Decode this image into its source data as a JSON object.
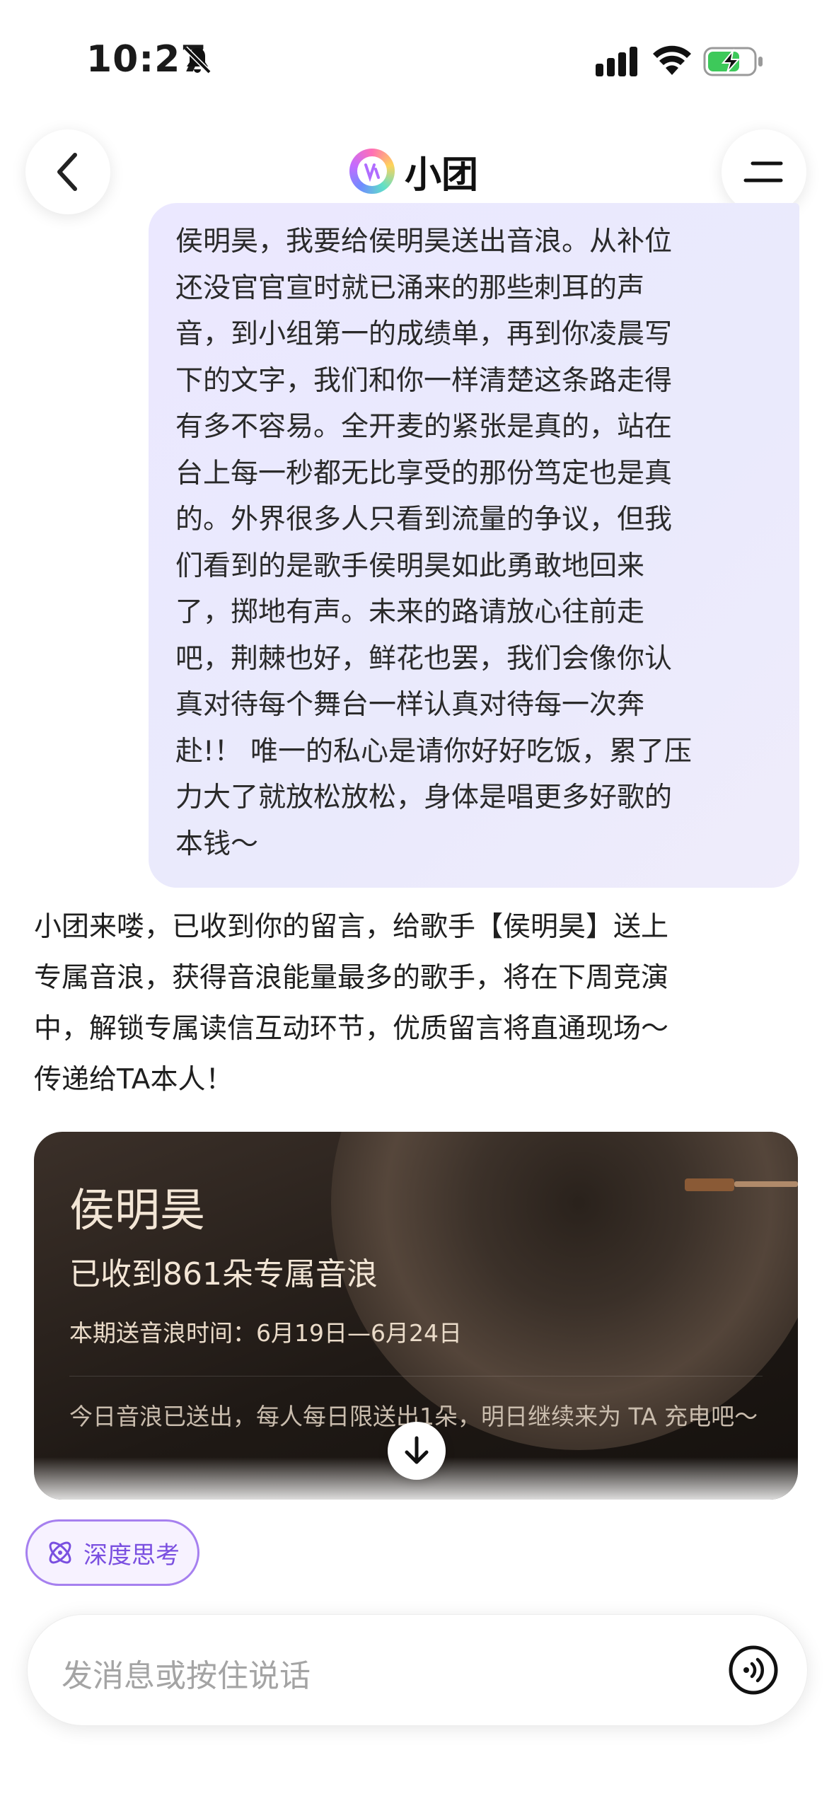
{
  "status_bar": {
    "time": "10:27"
  },
  "header": {
    "title": "小团"
  },
  "user_message": {
    "lines": [
      "侯明昊，我要给侯明昊送出音浪。从补位",
      "还没官官宣时就已涌来的那些刺耳的声",
      "音，到小组第一的成绩单，再到你凌晨写",
      "下的文字，我们和你一样清楚这条路走得",
      "有多不容易。全开麦的紧张是真的，站在",
      "台上每一秒都无比享受的那份笃定也是真",
      "的。外界很多人只看到流量的争议，但我",
      "们看到的是歌手侯明昊如此勇敢地回来",
      "了，掷地有声。未来的路请放心往前走",
      "吧，荆棘也好，鲜花也罢，我们会像你认",
      "真对待每个舞台一样认真对待每一次奔",
      "赴!！ 唯一的私心是请你好好吃饭，累了压",
      "力大了就放松放松，身体是唱更多好歌的",
      "本钱～"
    ]
  },
  "bot_message": {
    "lines": [
      "小团来喽，已收到你的留言，给歌手【侯明昊】送上",
      "专属音浪，获得音浪能量最多的歌手，将在下周竞演",
      "中，解锁专属读信互动环节，优质留言将直通现场～",
      "传递给TA本人！"
    ]
  },
  "card": {
    "name": "侯明昊",
    "received": "已收到861朵专属音浪",
    "period": "本期送音浪时间：6月19日—6月24日",
    "notice": "今日音浪已送出，每人每日限送出1朵，明日继续来为 TA 充电吧～"
  },
  "deep_think": {
    "label": "深度思考"
  },
  "input": {
    "placeholder": "发消息或按住说话"
  },
  "colors": {
    "accent": "#7a4fe0",
    "bubble": "#ebe8ff",
    "card_bg": "#1f1915"
  }
}
